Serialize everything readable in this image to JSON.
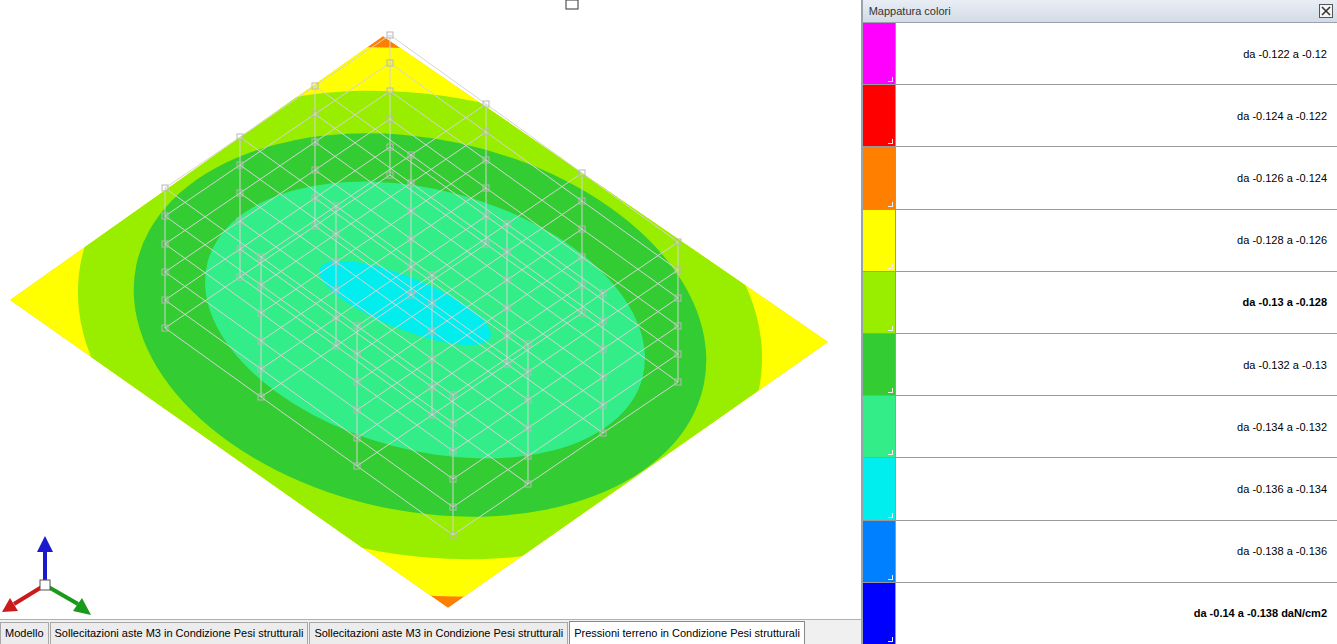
{
  "view": {
    "title": "Pressioni terreno in Condizione Pesi strutturali",
    "pressure_map": {
      "background": 2,
      "zones": [
        3,
        4,
        5,
        6,
        7
      ]
    }
  },
  "tabs": [
    {
      "label": "Modello",
      "selected": false
    },
    {
      "label": "Sollecitazioni aste M3 in Condizione Pesi strutturali",
      "selected": false
    },
    {
      "label": "Sollecitazioni aste M3 in Condizione Pesi strutturali",
      "selected": false
    },
    {
      "label": "Pressioni terreno in Condizione Pesi strutturali",
      "selected": true
    }
  ],
  "legend": {
    "title": "Mappatura colori",
    "items": [
      {
        "label": "da -0.122 a -0.12",
        "color": "#ff00ff",
        "bold": false
      },
      {
        "label": "da -0.124 a -0.122",
        "color": "#ff0000",
        "bold": false
      },
      {
        "label": "da -0.126 a -0.124",
        "color": "#ff8000",
        "bold": false
      },
      {
        "label": "da -0.128 a -0.126",
        "color": "#ffff00",
        "bold": false
      },
      {
        "label": "da -0.13 a -0.128",
        "color": "#99ee00",
        "bold": true
      },
      {
        "label": "da -0.132 a -0.13",
        "color": "#33cc33",
        "bold": false
      },
      {
        "label": "da -0.134 a -0.132",
        "color": "#33ee88",
        "bold": false
      },
      {
        "label": "da -0.136 a -0.134",
        "color": "#00eeee",
        "bold": false
      },
      {
        "label": "da -0.138 a -0.136",
        "color": "#0080ff",
        "bold": false
      },
      {
        "label": "da -0.14 a -0.138 daN/cm2",
        "color": "#0000ff",
        "bold": true
      }
    ]
  }
}
